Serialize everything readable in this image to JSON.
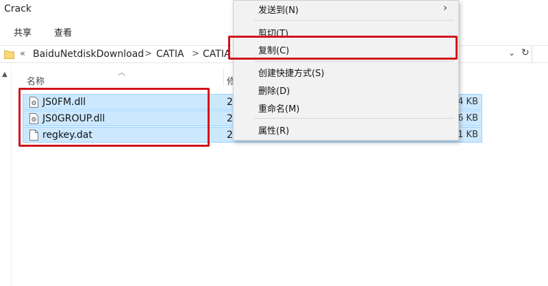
{
  "window": {
    "title": "Crack"
  },
  "ribbon": {
    "tabs": [
      "共享",
      "查看"
    ]
  },
  "address_bar": {
    "overflow": "«",
    "path": [
      "BaiduNetdiskDownload",
      "CATIA",
      "CATIA"
    ],
    "separator": ">",
    "dropdown_icon": "chevron-down",
    "refresh_icon": "refresh"
  },
  "columns": {
    "name": "名称",
    "date": "修"
  },
  "files": [
    {
      "name": "JS0FM.dll",
      "date": "2",
      "size": "4 KB",
      "icon": "dll-file-icon"
    },
    {
      "name": "JS0GROUP.dll",
      "date": "2",
      "size": "6 KB",
      "icon": "dll-file-icon"
    },
    {
      "name": "regkey.dat",
      "date": "2",
      "size": "1 KB",
      "icon": "blank-file-icon"
    }
  ],
  "context_menu": {
    "send_to": "发送到(N)",
    "cut": "剪切(T)",
    "copy": "复制(C)",
    "create_shortcut": "创建快捷方式(S)",
    "delete": "删除(D)",
    "rename": "重命名(M)",
    "properties": "属性(R)",
    "submenu_arrow": "›"
  },
  "annotations": {
    "color": "#d0121b"
  },
  "colors": {
    "selection": "#cce8ff",
    "selection_border": "#99d1ff",
    "menu_bg": "#f2f2f2"
  }
}
